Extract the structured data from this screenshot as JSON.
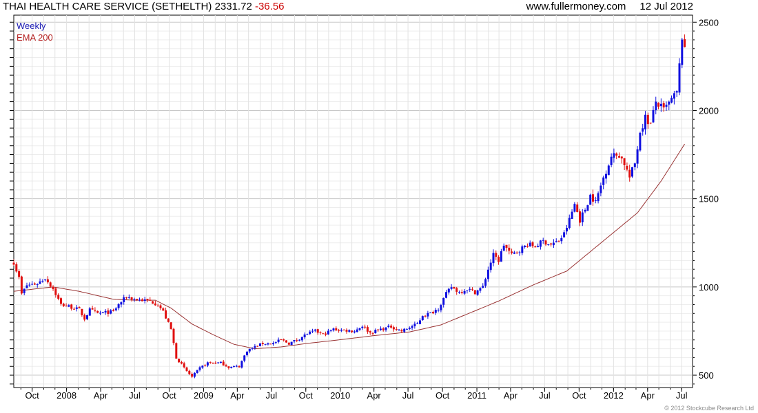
{
  "header": {
    "title": "THAI HEALTH CARE SERVICE (SETHELTH)",
    "price": "2331.72",
    "change": "-36.56",
    "website": "www.fullermoney.com",
    "date": "12 Jul 2012"
  },
  "copyright": "© 2012 Stockcube Research Ltd",
  "colors": {
    "up": "#1010e0",
    "down": "#e01010",
    "ema": "#993333",
    "grid": "#d4d4d4",
    "weekly_label": "#1a1ab4",
    "ema_label": "#b42020"
  },
  "chart_data": {
    "type": "candlestick",
    "legend": [
      "Weekly",
      "EMA 200"
    ],
    "legend_position": "top-left",
    "grid": true,
    "x_range": [
      "2007-08-13",
      "2012-07-30"
    ],
    "ylim": [
      430,
      2540
    ],
    "y_ticks": [
      500,
      1000,
      1500,
      2000,
      2500
    ],
    "y_axis_side": "right",
    "x_ticks": [
      {
        "label": "Oct",
        "date": "2007-10-01"
      },
      {
        "label": "2008",
        "date": "2008-01-01"
      },
      {
        "label": "Apr",
        "date": "2008-04-01"
      },
      {
        "label": "Jul",
        "date": "2008-07-01"
      },
      {
        "label": "Oct",
        "date": "2008-10-01"
      },
      {
        "label": "2009",
        "date": "2009-01-01"
      },
      {
        "label": "Apr",
        "date": "2009-04-01"
      },
      {
        "label": "Jul",
        "date": "2009-07-01"
      },
      {
        "label": "Oct",
        "date": "2009-10-01"
      },
      {
        "label": "2010",
        "date": "2010-01-01"
      },
      {
        "label": "Apr",
        "date": "2010-04-01"
      },
      {
        "label": "Jul",
        "date": "2010-07-01"
      },
      {
        "label": "Oct",
        "date": "2010-10-01"
      },
      {
        "label": "2011",
        "date": "2011-01-01"
      },
      {
        "label": "Apr",
        "date": "2011-04-01"
      },
      {
        "label": "Jul",
        "date": "2011-07-01"
      },
      {
        "label": "Oct",
        "date": "2011-10-01"
      },
      {
        "label": "2012",
        "date": "2012-01-01"
      },
      {
        "label": "Apr",
        "date": "2012-04-01"
      },
      {
        "label": "Jul",
        "date": "2012-07-01"
      }
    ],
    "close_anchors": [
      [
        "2007-08-13",
        1140
      ],
      [
        "2007-08-27",
        1050
      ],
      [
        "2007-09-03",
        960
      ],
      [
        "2007-09-17",
        1010
      ],
      [
        "2007-10-15",
        1020
      ],
      [
        "2007-11-05",
        1050
      ],
      [
        "2007-11-26",
        990
      ],
      [
        "2007-12-17",
        900
      ],
      [
        "2008-01-07",
        890
      ],
      [
        "2008-02-04",
        870
      ],
      [
        "2008-02-18",
        820
      ],
      [
        "2008-03-03",
        870
      ],
      [
        "2008-03-24",
        850
      ],
      [
        "2008-04-14",
        855
      ],
      [
        "2008-05-05",
        860
      ],
      [
        "2008-05-19",
        900
      ],
      [
        "2008-06-09",
        945
      ],
      [
        "2008-06-30",
        930
      ],
      [
        "2008-07-21",
        925
      ],
      [
        "2008-08-11",
        920
      ],
      [
        "2008-09-01",
        900
      ],
      [
        "2008-09-15",
        860
      ],
      [
        "2008-10-06",
        760
      ],
      [
        "2008-10-20",
        600
      ],
      [
        "2008-11-10",
        540
      ],
      [
        "2008-12-01",
        490
      ],
      [
        "2008-12-22",
        540
      ],
      [
        "2009-01-12",
        570
      ],
      [
        "2009-02-16",
        570
      ],
      [
        "2009-03-09",
        545
      ],
      [
        "2009-04-06",
        550
      ],
      [
        "2009-04-27",
        640
      ],
      [
        "2009-05-18",
        660
      ],
      [
        "2009-06-08",
        680
      ],
      [
        "2009-07-06",
        680
      ],
      [
        "2009-07-27",
        700
      ],
      [
        "2009-08-17",
        680
      ],
      [
        "2009-09-07",
        700
      ],
      [
        "2009-10-05",
        735
      ],
      [
        "2009-10-26",
        750
      ],
      [
        "2009-11-16",
        730
      ],
      [
        "2009-12-14",
        760
      ],
      [
        "2010-01-11",
        755
      ],
      [
        "2010-02-08",
        750
      ],
      [
        "2010-03-01",
        780
      ],
      [
        "2010-03-22",
        740
      ],
      [
        "2010-04-19",
        760
      ],
      [
        "2010-05-17",
        775
      ],
      [
        "2010-06-14",
        750
      ],
      [
        "2010-07-05",
        770
      ],
      [
        "2010-07-26",
        790
      ],
      [
        "2010-08-09",
        840
      ],
      [
        "2010-08-30",
        850
      ],
      [
        "2010-09-20",
        880
      ],
      [
        "2010-10-11",
        960
      ],
      [
        "2010-10-25",
        1000
      ],
      [
        "2010-11-15",
        970
      ],
      [
        "2010-12-06",
        990
      ],
      [
        "2010-12-27",
        970
      ],
      [
        "2011-01-17",
        1000
      ],
      [
        "2011-01-31",
        1100
      ],
      [
        "2011-02-14",
        1180
      ],
      [
        "2011-02-28",
        1150
      ],
      [
        "2011-03-14",
        1240
      ],
      [
        "2011-04-04",
        1180
      ],
      [
        "2011-04-25",
        1210
      ],
      [
        "2011-05-16",
        1240
      ],
      [
        "2011-06-06",
        1230
      ],
      [
        "2011-06-27",
        1260
      ],
      [
        "2011-07-18",
        1240
      ],
      [
        "2011-08-08",
        1260
      ],
      [
        "2011-08-22",
        1300
      ],
      [
        "2011-09-05",
        1380
      ],
      [
        "2011-09-19",
        1470
      ],
      [
        "2011-10-03",
        1380
      ],
      [
        "2011-10-17",
        1440
      ],
      [
        "2011-10-31",
        1520
      ],
      [
        "2011-11-14",
        1480
      ],
      [
        "2011-12-05",
        1620
      ],
      [
        "2011-12-26",
        1740
      ],
      [
        "2012-01-16",
        1750
      ],
      [
        "2012-01-30",
        1700
      ],
      [
        "2012-02-13",
        1620
      ],
      [
        "2012-02-27",
        1700
      ],
      [
        "2012-03-12",
        1880
      ],
      [
        "2012-03-26",
        1960
      ],
      [
        "2012-04-09",
        1920
      ],
      [
        "2012-04-23",
        2050
      ],
      [
        "2012-05-14",
        2000
      ],
      [
        "2012-06-04",
        2060
      ],
      [
        "2012-06-18",
        2100
      ],
      [
        "2012-06-25",
        2250
      ],
      [
        "2012-07-02",
        2420
      ],
      [
        "2012-07-09",
        2331.72
      ]
    ],
    "ema_anchors": [
      [
        "2007-08-13",
        975
      ],
      [
        "2007-11-26",
        1000
      ],
      [
        "2008-02-04",
        975
      ],
      [
        "2008-05-05",
        930
      ],
      [
        "2008-06-30",
        925
      ],
      [
        "2008-08-25",
        925
      ],
      [
        "2008-10-06",
        880
      ],
      [
        "2008-12-01",
        790
      ],
      [
        "2009-01-26",
        730
      ],
      [
        "2009-03-23",
        675
      ],
      [
        "2009-05-18",
        650
      ],
      [
        "2009-07-27",
        660
      ],
      [
        "2009-10-05",
        680
      ],
      [
        "2009-12-28",
        700
      ],
      [
        "2010-04-05",
        725
      ],
      [
        "2010-07-05",
        745
      ],
      [
        "2010-09-27",
        785
      ],
      [
        "2010-11-29",
        840
      ],
      [
        "2011-02-28",
        920
      ],
      [
        "2011-05-30",
        1010
      ],
      [
        "2011-08-29",
        1090
      ],
      [
        "2011-10-31",
        1200
      ],
      [
        "2012-01-02",
        1310
      ],
      [
        "2012-03-05",
        1420
      ],
      [
        "2012-05-07",
        1600
      ],
      [
        "2012-07-09",
        1810
      ]
    ]
  }
}
